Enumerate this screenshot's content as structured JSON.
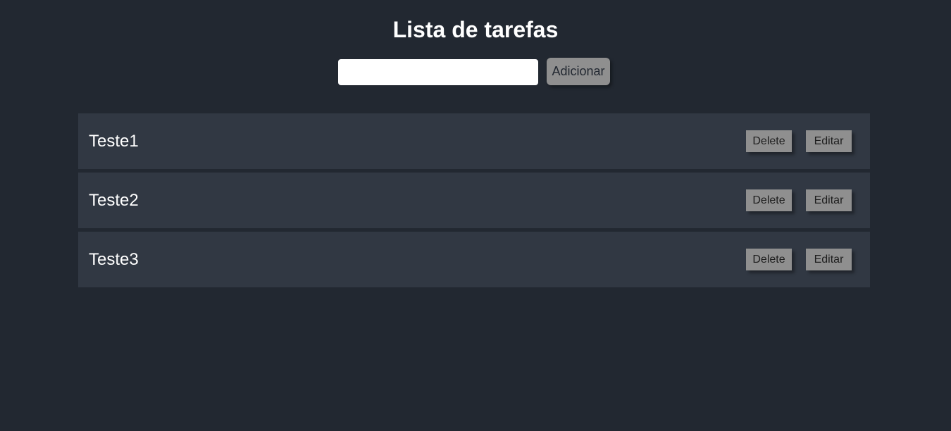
{
  "header": {
    "title": "Lista de tarefas"
  },
  "add_form": {
    "input_value": "",
    "input_placeholder": "",
    "add_label": "Adicionar"
  },
  "tasks": [
    {
      "text": "Teste1",
      "delete_label": "Delete",
      "edit_label": "Editar"
    },
    {
      "text": "Teste2",
      "delete_label": "Delete",
      "edit_label": "Editar"
    },
    {
      "text": "Teste3",
      "delete_label": "Delete",
      "edit_label": "Editar"
    }
  ],
  "colors": {
    "background": "#222831",
    "task_background": "#313843",
    "button_background": "#8f8f8f",
    "text": "#ffffff"
  }
}
